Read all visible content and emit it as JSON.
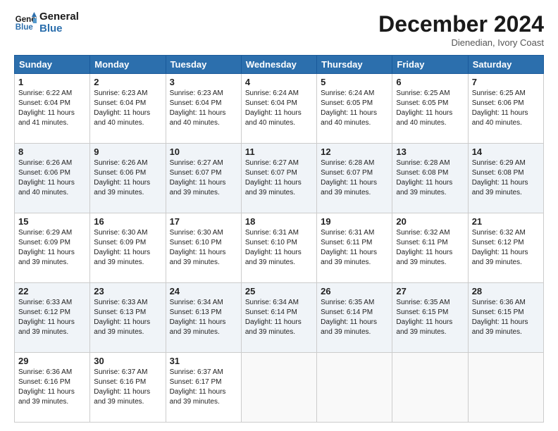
{
  "logo": {
    "line1": "General",
    "line2": "Blue"
  },
  "title": "December 2024",
  "location": "Dienedian, Ivory Coast",
  "days_header": [
    "Sunday",
    "Monday",
    "Tuesday",
    "Wednesday",
    "Thursday",
    "Friday",
    "Saturday"
  ],
  "weeks": [
    [
      {
        "day": "1",
        "sunrise": "6:22 AM",
        "sunset": "6:04 PM",
        "daylight": "11 hours and 41 minutes."
      },
      {
        "day": "2",
        "sunrise": "6:23 AM",
        "sunset": "6:04 PM",
        "daylight": "11 hours and 40 minutes."
      },
      {
        "day": "3",
        "sunrise": "6:23 AM",
        "sunset": "6:04 PM",
        "daylight": "11 hours and 40 minutes."
      },
      {
        "day": "4",
        "sunrise": "6:24 AM",
        "sunset": "6:04 PM",
        "daylight": "11 hours and 40 minutes."
      },
      {
        "day": "5",
        "sunrise": "6:24 AM",
        "sunset": "6:05 PM",
        "daylight": "11 hours and 40 minutes."
      },
      {
        "day": "6",
        "sunrise": "6:25 AM",
        "sunset": "6:05 PM",
        "daylight": "11 hours and 40 minutes."
      },
      {
        "day": "7",
        "sunrise": "6:25 AM",
        "sunset": "6:06 PM",
        "daylight": "11 hours and 40 minutes."
      }
    ],
    [
      {
        "day": "8",
        "sunrise": "6:26 AM",
        "sunset": "6:06 PM",
        "daylight": "11 hours and 40 minutes."
      },
      {
        "day": "9",
        "sunrise": "6:26 AM",
        "sunset": "6:06 PM",
        "daylight": "11 hours and 39 minutes."
      },
      {
        "day": "10",
        "sunrise": "6:27 AM",
        "sunset": "6:07 PM",
        "daylight": "11 hours and 39 minutes."
      },
      {
        "day": "11",
        "sunrise": "6:27 AM",
        "sunset": "6:07 PM",
        "daylight": "11 hours and 39 minutes."
      },
      {
        "day": "12",
        "sunrise": "6:28 AM",
        "sunset": "6:07 PM",
        "daylight": "11 hours and 39 minutes."
      },
      {
        "day": "13",
        "sunrise": "6:28 AM",
        "sunset": "6:08 PM",
        "daylight": "11 hours and 39 minutes."
      },
      {
        "day": "14",
        "sunrise": "6:29 AM",
        "sunset": "6:08 PM",
        "daylight": "11 hours and 39 minutes."
      }
    ],
    [
      {
        "day": "15",
        "sunrise": "6:29 AM",
        "sunset": "6:09 PM",
        "daylight": "11 hours and 39 minutes."
      },
      {
        "day": "16",
        "sunrise": "6:30 AM",
        "sunset": "6:09 PM",
        "daylight": "11 hours and 39 minutes."
      },
      {
        "day": "17",
        "sunrise": "6:30 AM",
        "sunset": "6:10 PM",
        "daylight": "11 hours and 39 minutes."
      },
      {
        "day": "18",
        "sunrise": "6:31 AM",
        "sunset": "6:10 PM",
        "daylight": "11 hours and 39 minutes."
      },
      {
        "day": "19",
        "sunrise": "6:31 AM",
        "sunset": "6:11 PM",
        "daylight": "11 hours and 39 minutes."
      },
      {
        "day": "20",
        "sunrise": "6:32 AM",
        "sunset": "6:11 PM",
        "daylight": "11 hours and 39 minutes."
      },
      {
        "day": "21",
        "sunrise": "6:32 AM",
        "sunset": "6:12 PM",
        "daylight": "11 hours and 39 minutes."
      }
    ],
    [
      {
        "day": "22",
        "sunrise": "6:33 AM",
        "sunset": "6:12 PM",
        "daylight": "11 hours and 39 minutes."
      },
      {
        "day": "23",
        "sunrise": "6:33 AM",
        "sunset": "6:13 PM",
        "daylight": "11 hours and 39 minutes."
      },
      {
        "day": "24",
        "sunrise": "6:34 AM",
        "sunset": "6:13 PM",
        "daylight": "11 hours and 39 minutes."
      },
      {
        "day": "25",
        "sunrise": "6:34 AM",
        "sunset": "6:14 PM",
        "daylight": "11 hours and 39 minutes."
      },
      {
        "day": "26",
        "sunrise": "6:35 AM",
        "sunset": "6:14 PM",
        "daylight": "11 hours and 39 minutes."
      },
      {
        "day": "27",
        "sunrise": "6:35 AM",
        "sunset": "6:15 PM",
        "daylight": "11 hours and 39 minutes."
      },
      {
        "day": "28",
        "sunrise": "6:36 AM",
        "sunset": "6:15 PM",
        "daylight": "11 hours and 39 minutes."
      }
    ],
    [
      {
        "day": "29",
        "sunrise": "6:36 AM",
        "sunset": "6:16 PM",
        "daylight": "11 hours and 39 minutes."
      },
      {
        "day": "30",
        "sunrise": "6:37 AM",
        "sunset": "6:16 PM",
        "daylight": "11 hours and 39 minutes."
      },
      {
        "day": "31",
        "sunrise": "6:37 AM",
        "sunset": "6:17 PM",
        "daylight": "11 hours and 39 minutes."
      },
      null,
      null,
      null,
      null
    ]
  ]
}
